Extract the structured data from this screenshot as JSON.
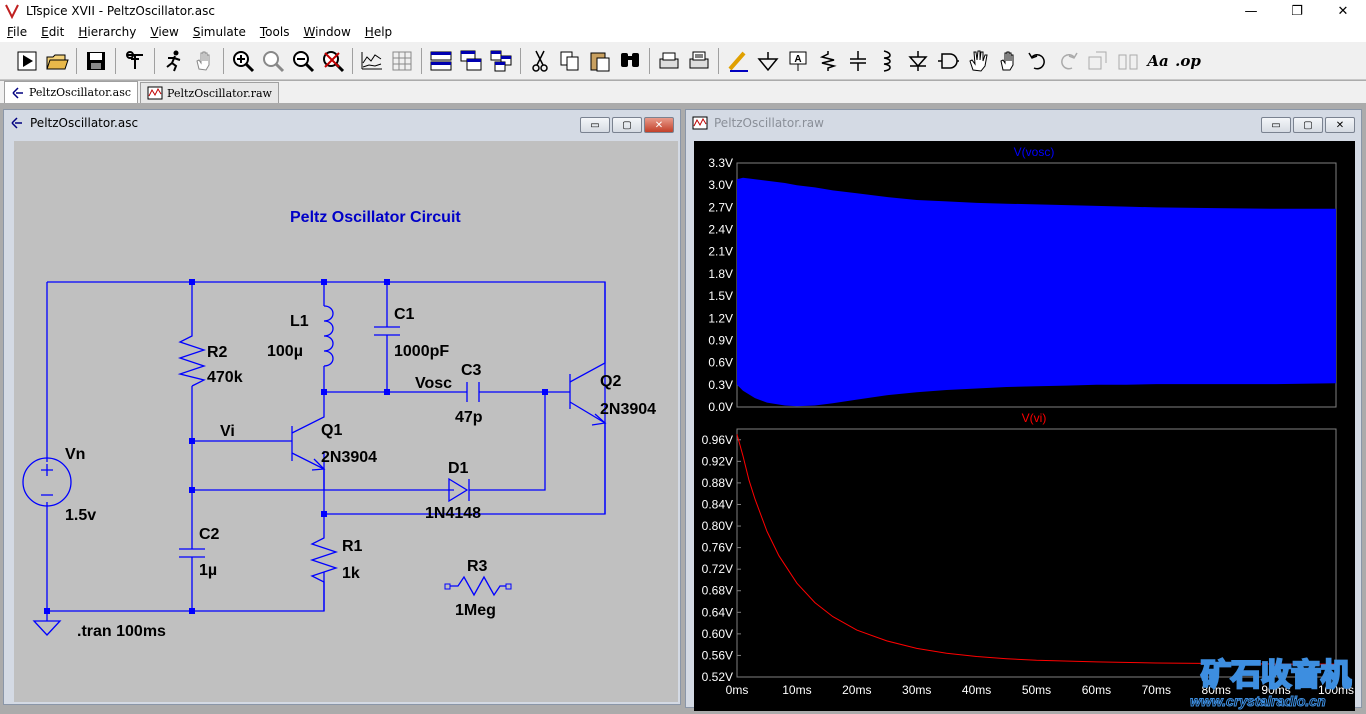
{
  "app": {
    "title": "LTspice XVII - PeltzOscillator.asc",
    "controls": {
      "minimize": "—",
      "restore": "❐",
      "close": "✕"
    }
  },
  "menu": [
    "File",
    "Edit",
    "Hierarchy",
    "View",
    "Simulate",
    "Tools",
    "Window",
    "Help"
  ],
  "toolbar": {
    "text_tool": "Aa",
    "op_tool": ".op",
    "icons": [
      "run-icon",
      "open-icon",
      "save-icon",
      "control-panel-icon",
      "halt-icon",
      "pan-icon",
      "zoom-in-icon",
      "zoom-pan-icon",
      "zoom-out-icon",
      "zoom-fit-icon",
      "autorange-icon",
      "grid-icon",
      "tile-horizontal-icon",
      "cascade-icon",
      "tile-icon",
      "cut-icon",
      "copy-icon",
      "paste-icon",
      "find-icon",
      "print-icon",
      "print-setup-icon",
      "draw-wire-icon",
      "ground-icon",
      "label-net-icon",
      "resistor-icon",
      "capacitor-icon",
      "inductor-icon",
      "diode-icon",
      "component-icon",
      "move-icon",
      "drag-icon",
      "undo-icon",
      "redo-icon",
      "rotate-icon",
      "mirror-icon"
    ]
  },
  "tabs": [
    {
      "label": "PeltzOscillator.asc",
      "active": true
    },
    {
      "label": "PeltzOscillator.raw",
      "active": false
    }
  ],
  "schematic": {
    "window_title": "PeltzOscillator.asc",
    "title_text": "Peltz Oscillator Circuit",
    "labels": {
      "Vn": "Vn",
      "Vn_val": "1.5v",
      "R2": "R2",
      "R2_val": "470k",
      "L1": "L1",
      "L1_val": "100µ",
      "C1": "C1",
      "C1_val": "1000pF",
      "C3": "C3",
      "C3_val": "47p",
      "Vosc": "Vosc",
      "Q2": "Q2",
      "Q2_val": "2N3904",
      "Q1": "Q1",
      "Q1_val": "2N3904",
      "Vi": "Vi",
      "D1": "D1",
      "D1_val": "1N4148",
      "C2": "C2",
      "C2_val": "1µ",
      "R1": "R1",
      "R1_val": "1k",
      "R3": "R3",
      "R3_val": "1Meg",
      "tran": ".tran 100ms"
    }
  },
  "waveform": {
    "window_title": "PeltzOscillator.raw",
    "colors": {
      "vosc": "#0000ff",
      "vi": "#ff0000",
      "axis_text": "#ffffff",
      "frame": "#808080"
    },
    "watermark": {
      "brand": "矿石收音机",
      "url": "www.crystalradio.cn"
    }
  },
  "chart_data": [
    {
      "type": "area",
      "title": "V(vosc)",
      "x_ticks": [
        "0ms",
        "10ms",
        "20ms",
        "30ms",
        "40ms",
        "50ms",
        "60ms",
        "70ms",
        "80ms",
        "90ms",
        "100ms"
      ],
      "y_ticks": [
        "3.3V",
        "3.0V",
        "2.7V",
        "2.4V",
        "2.1V",
        "1.8V",
        "1.5V",
        "1.2V",
        "0.9V",
        "0.6V",
        "0.3V",
        "0.0V"
      ],
      "xlim": [
        0,
        100
      ],
      "ylim": [
        0,
        3.3
      ],
      "x": [
        0,
        1,
        3,
        5,
        8,
        10,
        13,
        16,
        20,
        25,
        30,
        35,
        40,
        45,
        50,
        55,
        60,
        65,
        70,
        80,
        90,
        100
      ],
      "upper": [
        3.08,
        3.1,
        3.08,
        3.06,
        3.03,
        3.0,
        2.97,
        2.93,
        2.89,
        2.84,
        2.8,
        2.78,
        2.76,
        2.75,
        2.74,
        2.73,
        2.72,
        2.71,
        2.7,
        2.69,
        2.68,
        2.68
      ],
      "lower": [
        0.3,
        0.22,
        0.12,
        0.06,
        0.02,
        0.01,
        0.02,
        0.05,
        0.1,
        0.16,
        0.2,
        0.23,
        0.25,
        0.27,
        0.28,
        0.29,
        0.3,
        0.3,
        0.31,
        0.31,
        0.31,
        0.32
      ],
      "color": "#0000ff"
    },
    {
      "type": "line",
      "title": "V(vi)",
      "x_ticks": [
        "0ms",
        "10ms",
        "20ms",
        "30ms",
        "40ms",
        "50ms",
        "60ms",
        "70ms",
        "80ms",
        "90ms",
        "100ms"
      ],
      "y_ticks": [
        "0.96V",
        "0.92V",
        "0.88V",
        "0.84V",
        "0.80V",
        "0.76V",
        "0.72V",
        "0.68V",
        "0.64V",
        "0.60V",
        "0.56V",
        "0.52V"
      ],
      "xlim": [
        0,
        100
      ],
      "ylim": [
        0.52,
        0.98
      ],
      "x": [
        0,
        1,
        2,
        3,
        5,
        7,
        10,
        13,
        16,
        20,
        25,
        30,
        35,
        40,
        45,
        50,
        60,
        70,
        80,
        90,
        100
      ],
      "y": [
        0.97,
        0.93,
        0.885,
        0.85,
        0.79,
        0.745,
        0.694,
        0.658,
        0.632,
        0.607,
        0.587,
        0.573,
        0.564,
        0.558,
        0.554,
        0.551,
        0.548,
        0.546,
        0.545,
        0.544,
        0.544
      ],
      "color": "#ff0000"
    }
  ]
}
